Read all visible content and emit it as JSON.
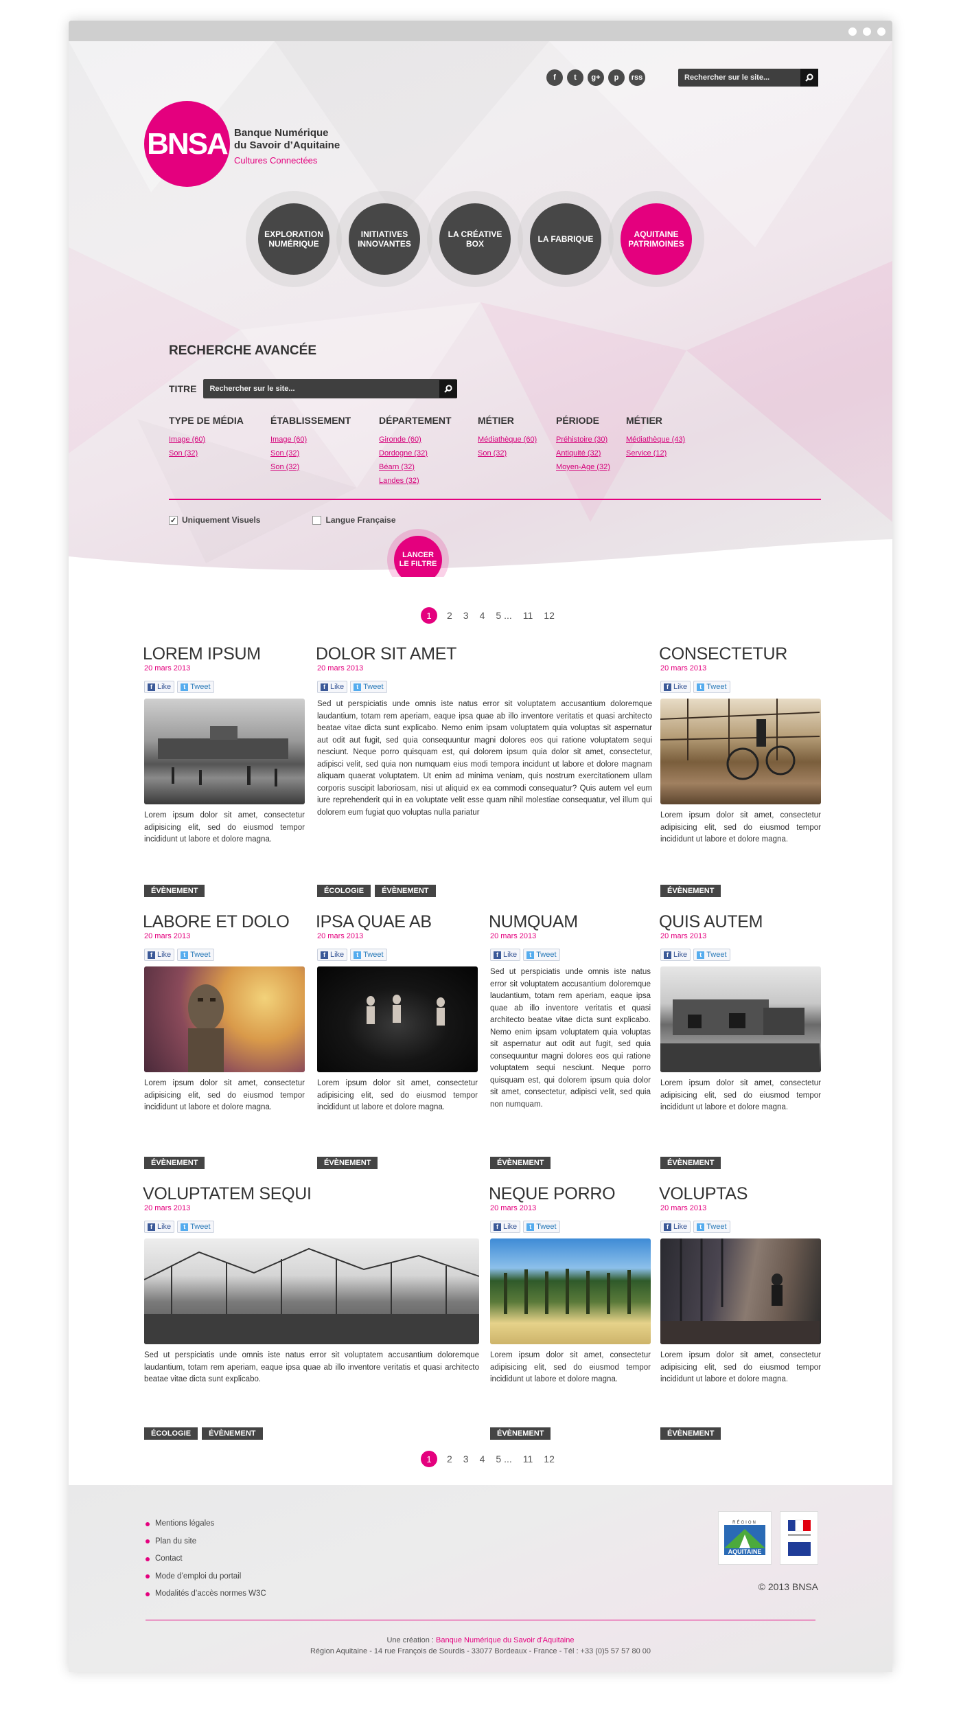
{
  "topbar": {
    "social": [
      "f",
      "t",
      "g+",
      "p",
      "rss"
    ],
    "search_placeholder": "Rechercher sur le site..."
  },
  "logo": {
    "mark": "BNSA",
    "line1": "Banque Numérique",
    "line2": "du Savoir d’Aquitaine",
    "tagline": "Cultures Connectées"
  },
  "nav": [
    {
      "label": "EXPLORATION\nNUMÉRIQUE"
    },
    {
      "label": "INITIATIVES\nINNOVANTES"
    },
    {
      "label": "LA CRÉATIVE\nBOX"
    },
    {
      "label": "LA FABRIQUE"
    },
    {
      "label": "AQUITAINE\nPATRIMOINES"
    }
  ],
  "advanced": {
    "title": "RECHERCHE AVANCÉE",
    "titre_label": "TITRE",
    "titre_placeholder": "Rechercher sur le site...",
    "filters": [
      {
        "heading": "TYPE DE MÉDIA",
        "items": [
          "Image (60)",
          "Son (32)"
        ]
      },
      {
        "heading": "ÉTABLISSEMENT",
        "items": [
          "Image (60)",
          "Son (32)",
          "Son (32)"
        ]
      },
      {
        "heading": "DÉPARTEMENT",
        "items": [
          "Gironde (60)",
          "Dordogne (32)",
          "Béarn (32)",
          "Landes (32)"
        ]
      },
      {
        "heading": "MÉTIER",
        "items": [
          "Médiathèque (60)",
          "Son (32)"
        ]
      },
      {
        "heading": "PÉRIODE",
        "items": [
          "Préhistoire (30)",
          "Antiquité (32)",
          "Moyen-Age (32)"
        ]
      },
      {
        "heading": "MÉTIER",
        "items": [
          "Médiathèque (43)",
          "Service (12)"
        ]
      }
    ],
    "check1": "Uniquement Visuels",
    "check2": "Langue Française",
    "launch": "LANCER\nLE FILTRE"
  },
  "pager": [
    "1",
    "2",
    "3",
    "4",
    "5 ...",
    "11",
    "12"
  ],
  "share": {
    "like": "Like",
    "tweet": "Tweet"
  },
  "cards": [
    {
      "title": "LOREM IPSUM",
      "date": "20 mars 2013",
      "text": "Lorem ipsum dolor sit amet, consectetur adipisicing elit, sed do eiusmod tempor incididunt ut labore et dolore magna.",
      "tags": [
        "ÉVÈNEMENT"
      ]
    },
    {
      "title": "DOLOR SIT AMET",
      "date": "20 mars 2013",
      "text": "Sed ut perspiciatis unde omnis iste natus error sit voluptatem accusantium doloremque laudantium, totam rem aperiam, eaque ipsa quae ab illo inventore veritatis et quasi architecto beatae vitae dicta sunt explicabo. Nemo enim ipsam voluptatem quia voluptas sit aspernatur aut odit aut fugit, sed quia consequuntur magni dolores eos qui ratione voluptatem sequi nesciunt. Neque porro quisquam est, qui dolorem ipsum quia dolor sit amet, consectetur, adipisci velit, sed quia non numquam eius modi tempora incidunt ut labore et dolore magnam aliquam quaerat voluptatem. Ut enim ad minima veniam, quis nostrum exercitationem ullam corporis suscipit laboriosam, nisi ut aliquid ex ea commodi consequatur? Quis autem vel eum iure reprehenderit qui in ea voluptate velit esse quam nihil molestiae consequatur, vel illum qui dolorem eum fugiat quo voluptas nulla pariatur",
      "tags": [
        "ÉCOLOGIE",
        "ÉVÈNEMENT"
      ]
    },
    {
      "title": "CONSECTETUR",
      "date": "20 mars 2013",
      "text": "Lorem ipsum dolor sit amet, consectetur adipisicing elit, sed do eiusmod tempor incididunt ut labore et dolore magna.",
      "tags": [
        "ÉVÈNEMENT"
      ]
    },
    {
      "title": "LABORE ET DOLO",
      "date": "20 mars 2013",
      "text": "Lorem ipsum dolor sit amet, consectetur adipisicing elit, sed do eiusmod tempor incididunt ut labore et dolore magna.",
      "tags": [
        "ÉVÈNEMENT"
      ]
    },
    {
      "title": "IPSA QUAE AB",
      "date": "20 mars 2013",
      "text": "Lorem ipsum dolor sit amet, consectetur adipisicing elit, sed do eiusmod tempor incididunt ut labore et dolore magna.",
      "tags": [
        "ÉVÈNEMENT"
      ]
    },
    {
      "title": "NUMQUAM",
      "date": "20 mars 2013",
      "text": "Sed ut perspiciatis unde omnis iste natus error sit voluptatem accusantium doloremque laudantium, totam rem aperiam, eaque ipsa quae ab illo inventore veritatis et quasi architecto beatae vitae dicta sunt explicabo. Nemo enim ipsam voluptatem quia voluptas sit aspernatur aut odit aut fugit, sed quia consequuntur magni dolores eos qui ratione voluptatem sequi nesciunt. Neque porro quisquam est, qui dolorem ipsum quia dolor sit amet, consectetur, adipisci velit, sed quia non numquam.",
      "tags": [
        "ÉVÈNEMENT"
      ]
    },
    {
      "title": "QUIS AUTEM",
      "date": "20 mars 2013",
      "text": "Lorem ipsum dolor sit amet, consectetur adipisicing elit, sed do eiusmod tempor incididunt ut labore et dolore magna.",
      "tags": [
        "ÉVÈNEMENT"
      ]
    },
    {
      "title": "VOLUPTATEM SEQUI",
      "date": "20 mars 2013",
      "text": "Sed ut perspiciatis unde omnis iste natus error sit voluptatem accusantium doloremque laudantium, totam rem aperiam, eaque ipsa quae ab illo inventore veritatis et quasi architecto beatae vitae dicta sunt explicabo.",
      "tags": [
        "ÉCOLOGIE",
        "ÉVÈNEMENT"
      ]
    },
    {
      "title": "NEQUE PORRO",
      "date": "20 mars 2013",
      "text": "Lorem ipsum dolor sit amet, consectetur adipisicing elit, sed do eiusmod tempor incididunt ut labore et dolore magna.",
      "tags": [
        "ÉVÈNEMENT"
      ]
    },
    {
      "title": "VOLUPTAS",
      "date": "20 mars 2013",
      "text": "Lorem ipsum dolor sit amet, consectetur adipisicing elit, sed do eiusmod tempor incididunt ut labore et dolore magna.",
      "tags": [
        "ÉVÈNEMENT"
      ]
    }
  ],
  "footer": {
    "links": [
      "Mentions légales",
      "Plan du site",
      "Contact",
      "Mode d’emploi du portail",
      "Modalités d’accès normes W3C"
    ],
    "logo1": "AQUITAINE",
    "logo1_top": "RÉGION",
    "copyright": "© 2013 BNSA",
    "credit_prefix": "Une création : ",
    "credit_name": "Banque Numérique du Savoir d'Aquitaine",
    "address": "Région Aquitaine - 14 rue François de Sourdis - 33077 Bordeaux - France - Tél : +33 (0)5 57 57 80 00"
  },
  "colors": {
    "accent": "#e4007e",
    "dark": "#474747"
  }
}
